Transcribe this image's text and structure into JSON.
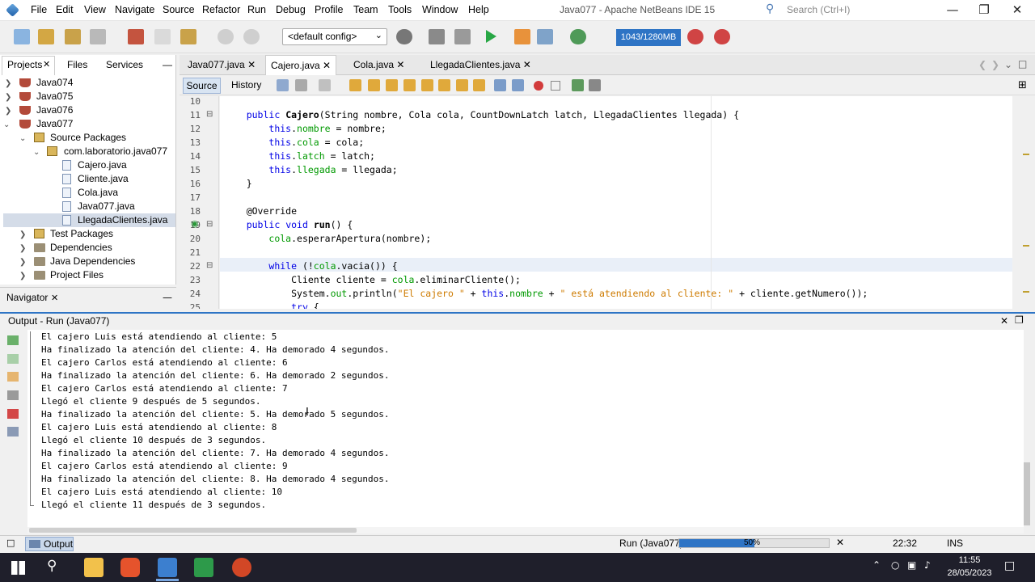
{
  "window": {
    "title": "Java077 - Apache NetBeans IDE 15"
  },
  "menu": [
    "File",
    "Edit",
    "View",
    "Navigate",
    "Source",
    "Refactor",
    "Run",
    "Debug",
    "Profile",
    "Team",
    "Tools",
    "Window",
    "Help"
  ],
  "search": {
    "placeholder": "Search (Ctrl+I)"
  },
  "toolbar": {
    "config": "<default config>",
    "memory": "1043/1280MB"
  },
  "projects_panel": {
    "tabs": [
      "Projects",
      "Files",
      "Services"
    ],
    "tree": [
      {
        "label": "Java074"
      },
      {
        "label": "Java075"
      },
      {
        "label": "Java076"
      },
      {
        "label": "Java077"
      },
      {
        "label": "Source Packages"
      },
      {
        "label": "com.laboratorio.java077"
      },
      {
        "label": "Cajero.java"
      },
      {
        "label": "Cliente.java"
      },
      {
        "label": "Cola.java"
      },
      {
        "label": "Java077.java"
      },
      {
        "label": "LlegadaClientes.java"
      },
      {
        "label": "Test Packages"
      },
      {
        "label": "Dependencies"
      },
      {
        "label": "Java Dependencies"
      },
      {
        "label": "Project Files"
      }
    ]
  },
  "navigator": {
    "title": "Navigator"
  },
  "editor": {
    "tabs": [
      "Java077.java",
      "Cajero.java",
      "Cola.java",
      "LlegadaClientes.java"
    ],
    "active_tab": "Cajero.java",
    "view_tabs": [
      "Source",
      "History"
    ],
    "line_numbers": [
      "10",
      "11",
      "12",
      "13",
      "14",
      "15",
      "16",
      "17",
      "18",
      "19",
      "20",
      "21",
      "22",
      "23",
      "24",
      "25"
    ],
    "lines": [
      "",
      "    public Cajero(String nombre, Cola cola, CountDownLatch latch, LlegadaClientes llegada) {",
      "        this.nombre = nombre;",
      "        this.cola = cola;",
      "        this.latch = latch;",
      "        this.llegada = llegada;",
      "    }",
      "",
      "    @Override",
      "    public void run() {",
      "        cola.esperarApertura(nombre);",
      "",
      "        while (!cola.vacia()) {",
      "            Cliente cliente = cola.eliminarCliente();",
      "            System.out.println(\"El cajero \" + this.nombre + \" está atendiendo al cliente: \" + cliente.getNumero());",
      "            try {"
    ]
  },
  "output": {
    "title": "Output - Run (Java077)",
    "lines": [
      "El cajero Luis está atendiendo al cliente: 5",
      "Ha finalizado la atención del cliente: 4. Ha demorado 4 segundos.",
      "El cajero Carlos está atendiendo al cliente: 6",
      "Ha finalizado la atención del cliente: 6. Ha demorado 2 segundos.",
      "El cajero Carlos está atendiendo al cliente: 7",
      "Llegó el cliente 9 después de 5 segundos.",
      "Ha finalizado la atención del cliente: 5. Ha demorado 5 segundos.",
      "El cajero Luis está atendiendo al cliente: 8",
      "Llegó el cliente 10 después de 3 segundos.",
      "Ha finalizado la atención del cliente: 7. Ha demorado 4 segundos.",
      "El cajero Carlos está atendiendo al cliente: 9",
      "Ha finalizado la atención del cliente: 8. Ha demorado 4 segundos.",
      "El cajero Luis está atendiendo al cliente: 10",
      "Llegó el cliente 11 después de 3 segundos."
    ]
  },
  "status": {
    "output_tab": "Output",
    "run_label": "Run (Java077)",
    "progress_label": "50%",
    "progress": 0.5,
    "position": "22:32",
    "mode": "INS"
  },
  "taskbar": {
    "time": "11:55",
    "date": "28/05/2023"
  },
  "colors": {
    "accent": "#2e74c5",
    "keyword": "#0000e6",
    "field": "#009900",
    "string": "#ce7b00"
  }
}
